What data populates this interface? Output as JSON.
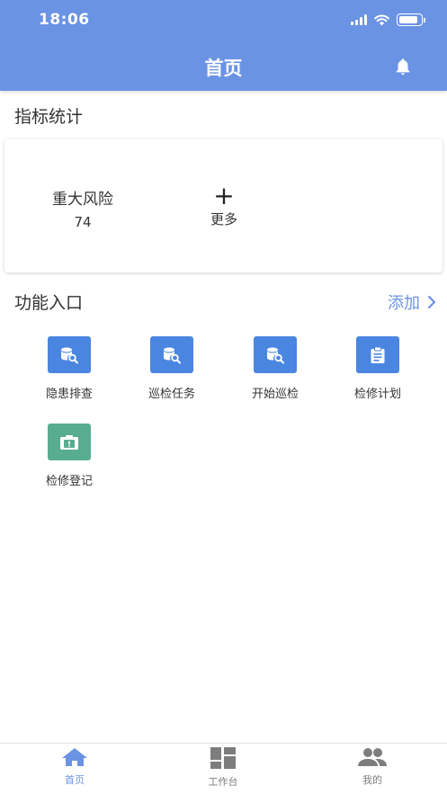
{
  "status_bar": {
    "time": "18:06",
    "battery_level": 0.85
  },
  "nav": {
    "title": "首页",
    "bell_icon": "bell-icon"
  },
  "stats": {
    "title": "指标统计",
    "items": [
      {
        "label": "重大风险",
        "value": "74"
      }
    ],
    "more_label": "更多"
  },
  "functions": {
    "title": "功能入口",
    "add_label": "添加",
    "items": [
      {
        "label": "隐患排查",
        "icon": "database-search-icon",
        "color": "#4a86e0"
      },
      {
        "label": "巡检任务",
        "icon": "database-search-icon",
        "color": "#4a86e0"
      },
      {
        "label": "开始巡检",
        "icon": "database-search-icon",
        "color": "#4a86e0"
      },
      {
        "label": "检修计划",
        "icon": "clipboard-icon",
        "color": "#4a86e0"
      },
      {
        "label": "检修登记",
        "icon": "alert-box-icon",
        "color": "#58ad91"
      }
    ]
  },
  "tabbar": {
    "items": [
      {
        "label": "首页",
        "icon": "home-icon",
        "active": true
      },
      {
        "label": "工作台",
        "icon": "dashboard-icon",
        "active": false
      },
      {
        "label": "我的",
        "icon": "people-icon",
        "active": false
      }
    ],
    "active_color": "#6b93e4",
    "inactive_color": "#7d7d7d"
  },
  "colors": {
    "primary": "#6b93e4"
  }
}
